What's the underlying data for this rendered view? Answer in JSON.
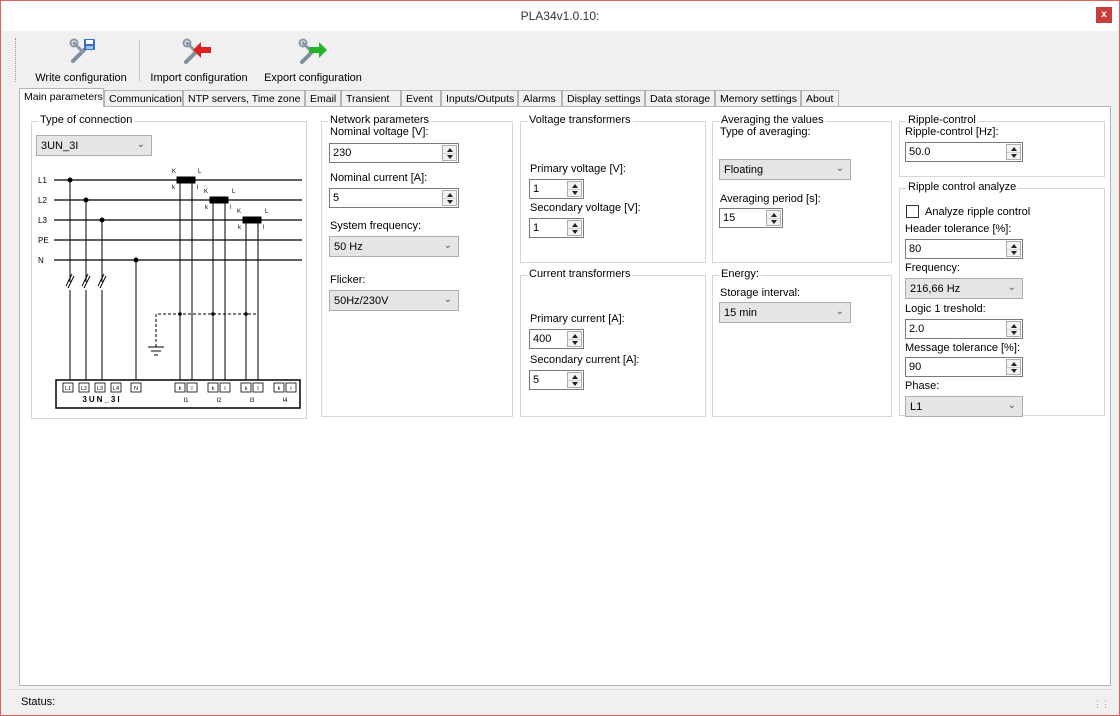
{
  "window": {
    "title": "PLA34v1.0.10:",
    "close_glyph": "x"
  },
  "toolbar": {
    "write_label": "Write configuration",
    "import_label": "Import configuration",
    "export_label": "Export configuration"
  },
  "tabs": [
    "Main parameters",
    "Communication",
    "NTP servers, Time zone",
    "Email",
    "Transient",
    "Event",
    "Inputs/Outputs",
    "Alarms",
    "Display settings",
    "Data storage",
    "Memory settings",
    "About"
  ],
  "connection": {
    "title": "Type of connection",
    "selected": "3UN_3I",
    "diagram": {
      "lines": [
        "L1",
        "L2",
        "L3",
        "PE",
        "N"
      ],
      "ct_k": "K",
      "ct_l": "L",
      "ct_sk": "k",
      "ct_sl": "l",
      "terminals_u": [
        "L1",
        "L2",
        "L3",
        "L4",
        "N"
      ],
      "terminals_i": [
        "k",
        "l",
        "k",
        "l",
        "k",
        "l",
        "k",
        "l"
      ],
      "caption_u": "3UN_3I",
      "captions_i": [
        "I1",
        "I2",
        "I3",
        "I4"
      ]
    }
  },
  "network": {
    "title": "Network parameters",
    "nominal_voltage_label": "Nominal voltage [V]:",
    "nominal_voltage": "230",
    "nominal_current_label": "Nominal current [A]:",
    "nominal_current": "5",
    "system_frequency_label": "System frequency:",
    "system_frequency": "50 Hz",
    "flicker_label": "Flicker:",
    "flicker": "50Hz/230V"
  },
  "vt": {
    "title": "Voltage transformers",
    "primary_label": "Primary voltage [V]:",
    "primary": "1",
    "secondary_label": "Secondary voltage [V]:",
    "secondary": "1"
  },
  "ct": {
    "title": "Current transformers",
    "primary_label": "Primary current [A]:",
    "primary": "400",
    "secondary_label": "Secondary current [A]:",
    "secondary": "5"
  },
  "averaging": {
    "title": "Averaging the values",
    "type_label": "Type of averaging:",
    "type": "Floating",
    "period_label": "Averaging period [s]:",
    "period": "15"
  },
  "energy": {
    "title": "Energy:",
    "interval_label": "Storage interval:",
    "interval": "15 min"
  },
  "ripple": {
    "title": "Ripple-control",
    "freq_label": "Ripple-control [Hz]:",
    "freq": "50.0"
  },
  "ripple_analyze": {
    "title": "Ripple control analyze",
    "analyze_label": "Analyze ripple control",
    "header_tol_label": "Header tolerance [%]:",
    "header_tol": "80",
    "frequency_label": "Frequency:",
    "frequency": "216,66 Hz",
    "logic1_label": "Logic 1 treshold:",
    "logic1": "2.0",
    "msg_tol_label": "Message tolerance [%]:",
    "msg_tol": "90",
    "phase_label": "Phase:",
    "phase": "L1"
  },
  "status": {
    "label": "Status:"
  },
  "icons": {
    "write": "write-config-icon",
    "import": "import-config-icon",
    "export": "export-config-icon",
    "accent_red": "#e02020",
    "accent_green": "#28b428"
  }
}
